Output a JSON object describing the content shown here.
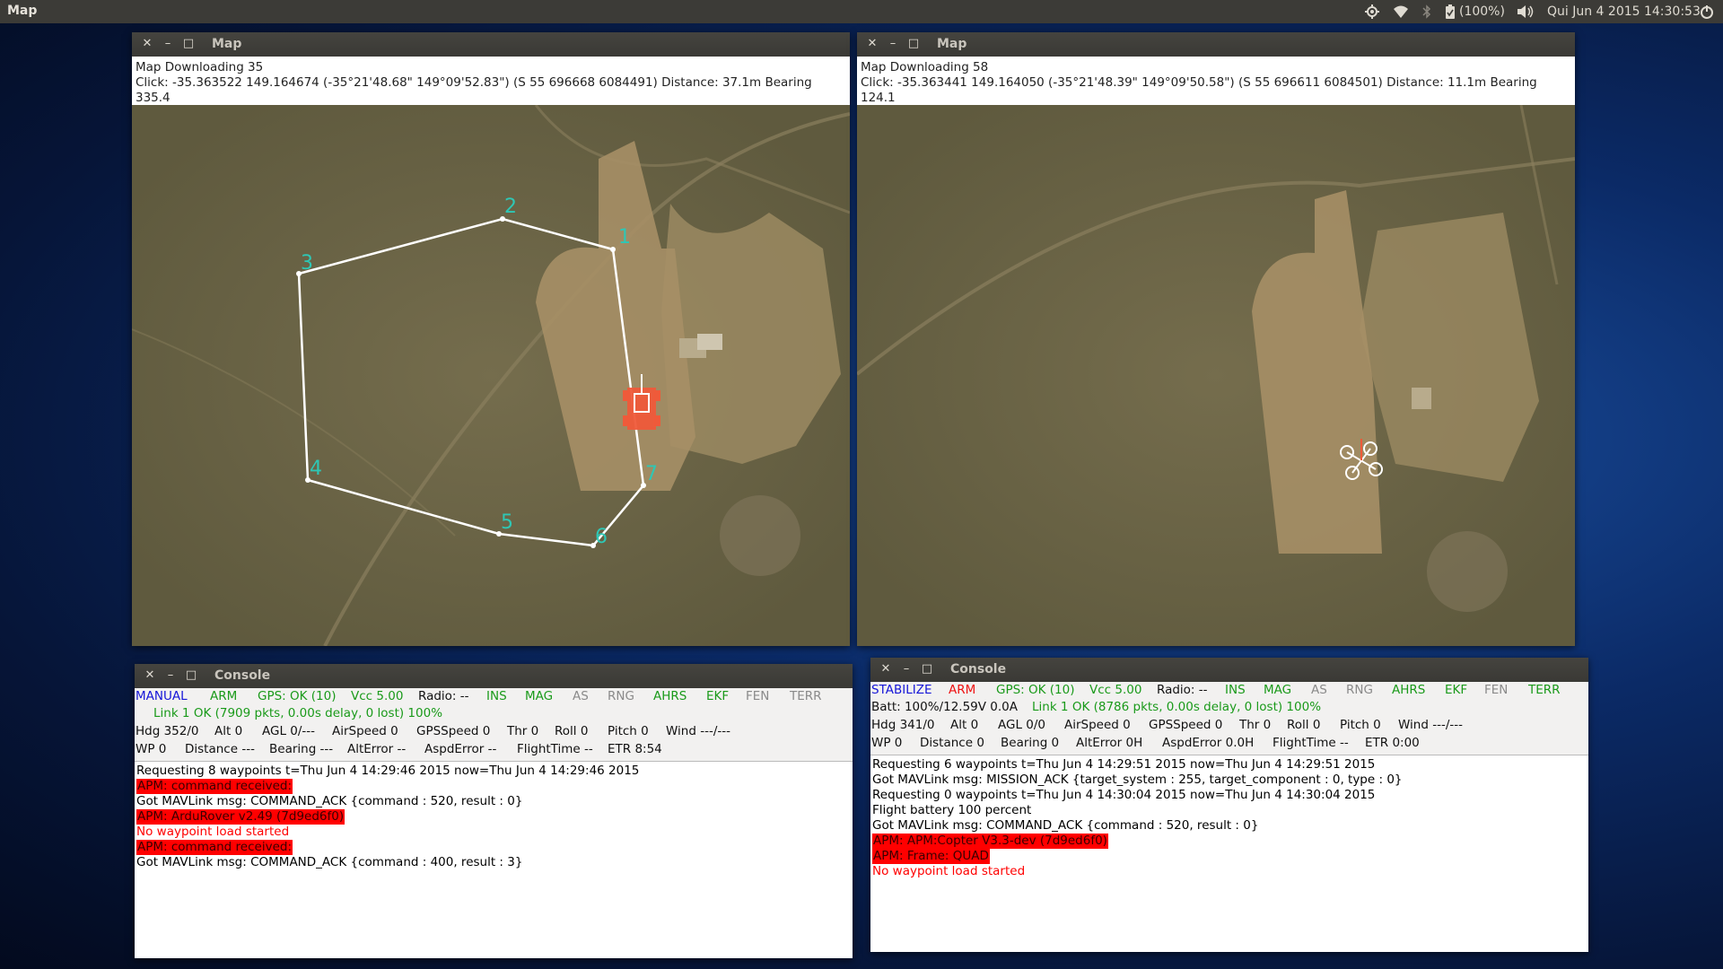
{
  "topbar": {
    "app_name": "Map",
    "battery": "(100%)",
    "clock": "Qui Jun  4 2015 14:30:53"
  },
  "icons": [
    "settings-icon",
    "wifi-icon",
    "bluetooth-icon",
    "battery-icon",
    "volume-icon",
    "session-icon",
    "close-icon",
    "minimize-icon",
    "maximize-icon"
  ],
  "map1": {
    "title": "Map",
    "line1": "Map Downloading 35",
    "line2": "Click: -35.363522 149.164674 (-35°21'48.68\" 149°09'52.83\") (S 55 696668 6084491)  Distance: 37.1m Bearing 335.4",
    "waypoints": [
      "1",
      "2",
      "3",
      "4",
      "5",
      "6",
      "7"
    ]
  },
  "map2": {
    "title": "Map",
    "line1": "Map Downloading 58",
    "line2": "Click: -35.363441 149.164050 (-35°21'48.39\" 149°09'50.58\") (S 55 696611 6084501)  Distance: 11.1m Bearing 124.1"
  },
  "console1": {
    "title": "Console",
    "row1": [
      {
        "t": "MANUAL",
        "c": "blue"
      },
      {
        "t": "ARM",
        "c": "green"
      },
      {
        "t": "GPS: OK (10)",
        "c": "green"
      },
      {
        "t": "Vcc 5.00",
        "c": "green"
      },
      {
        "t": "Radio: --",
        "c": "black"
      },
      {
        "t": "INS",
        "c": "green"
      },
      {
        "t": "MAG",
        "c": "green"
      },
      {
        "t": "AS",
        "c": "grey"
      },
      {
        "t": "RNG",
        "c": "grey"
      },
      {
        "t": "AHRS",
        "c": "green"
      },
      {
        "t": "EKF",
        "c": "green"
      },
      {
        "t": "FEN",
        "c": "grey"
      },
      {
        "t": "TERR",
        "c": "grey"
      }
    ],
    "row2": [
      {
        "t": "Link 1 OK (7909 pkts, 0.00s delay, 0 lost) 100%",
        "c": "green"
      }
    ],
    "row3": [
      {
        "t": "Hdg 352/0",
        "c": "black"
      },
      {
        "t": "Alt 0",
        "c": "black"
      },
      {
        "t": "AGL 0/---",
        "c": "black"
      },
      {
        "t": "AirSpeed 0",
        "c": "black"
      },
      {
        "t": "GPSSpeed 0",
        "c": "black"
      },
      {
        "t": "Thr 0",
        "c": "black"
      },
      {
        "t": "Roll 0",
        "c": "black"
      },
      {
        "t": "Pitch 0",
        "c": "black"
      },
      {
        "t": "Wind ---/---",
        "c": "black"
      }
    ],
    "row4": [
      {
        "t": "WP 0",
        "c": "black"
      },
      {
        "t": "Distance ---",
        "c": "black"
      },
      {
        "t": "Bearing ---",
        "c": "black"
      },
      {
        "t": "AltError --",
        "c": "black"
      },
      {
        "t": "AspdError --",
        "c": "black"
      },
      {
        "t": "FlightTime --",
        "c": "black"
      },
      {
        "t": "ETR 8:54",
        "c": "black"
      }
    ],
    "log": [
      {
        "t": "Requesting 8 waypoints t=Thu Jun  4 14:29:46 2015 now=Thu Jun  4 14:29:46 2015",
        "s": "normal"
      },
      {
        "t": "APM: command received:",
        "s": "hl"
      },
      {
        "t": "Got MAVLink msg: COMMAND_ACK {command : 520, result : 0}",
        "s": "normal"
      },
      {
        "t": "APM: ArduRover v2.49 (7d9ed6f0)",
        "s": "hl"
      },
      {
        "t": "No waypoint load started",
        "s": "red"
      },
      {
        "t": "APM: command received:",
        "s": "hl"
      },
      {
        "t": "Got MAVLink msg: COMMAND_ACK {command : 400, result : 3}",
        "s": "normal"
      }
    ]
  },
  "console2": {
    "title": "Console",
    "row1": [
      {
        "t": "STABILIZE",
        "c": "blue"
      },
      {
        "t": "ARM",
        "c": "red"
      },
      {
        "t": "GPS: OK (10)",
        "c": "green"
      },
      {
        "t": "Vcc 5.00",
        "c": "green"
      },
      {
        "t": "Radio: --",
        "c": "black"
      },
      {
        "t": "INS",
        "c": "green"
      },
      {
        "t": "MAG",
        "c": "green"
      },
      {
        "t": "AS",
        "c": "grey"
      },
      {
        "t": "RNG",
        "c": "grey"
      },
      {
        "t": "AHRS",
        "c": "green"
      },
      {
        "t": "EKF",
        "c": "green"
      },
      {
        "t": "FEN",
        "c": "grey"
      },
      {
        "t": "TERR",
        "c": "green"
      }
    ],
    "row2": [
      {
        "t": "Batt: 100%/12.59V 0.0A",
        "c": "black"
      },
      {
        "t": "Link 1 OK (8786 pkts, 0.00s delay, 0 lost) 100%",
        "c": "green"
      }
    ],
    "row3": [
      {
        "t": "Hdg 341/0",
        "c": "black"
      },
      {
        "t": "Alt 0",
        "c": "black"
      },
      {
        "t": "AGL 0/0",
        "c": "black"
      },
      {
        "t": "AirSpeed 0",
        "c": "black"
      },
      {
        "t": "GPSSpeed 0",
        "c": "black"
      },
      {
        "t": "Thr 0",
        "c": "black"
      },
      {
        "t": "Roll 0",
        "c": "black"
      },
      {
        "t": "Pitch 0",
        "c": "black"
      },
      {
        "t": "Wind ---/---",
        "c": "black"
      }
    ],
    "row4": [
      {
        "t": "WP 0",
        "c": "black"
      },
      {
        "t": "Distance 0",
        "c": "black"
      },
      {
        "t": "Bearing 0",
        "c": "black"
      },
      {
        "t": "AltError 0H",
        "c": "black"
      },
      {
        "t": "AspdError 0.0H",
        "c": "black"
      },
      {
        "t": "FlightTime --",
        "c": "black"
      },
      {
        "t": "ETR 0:00",
        "c": "black"
      }
    ],
    "log": [
      {
        "t": "Requesting 6 waypoints t=Thu Jun  4 14:29:51 2015 now=Thu Jun  4 14:29:51 2015",
        "s": "normal"
      },
      {
        "t": "Got MAVLink msg: MISSION_ACK {target_system : 255, target_component : 0, type : 0}",
        "s": "normal"
      },
      {
        "t": "Requesting 0 waypoints t=Thu Jun  4 14:30:04 2015 now=Thu Jun  4 14:30:04 2015",
        "s": "normal"
      },
      {
        "t": "Flight battery 100 percent",
        "s": "normal"
      },
      {
        "t": "Got MAVLink msg: COMMAND_ACK {command : 520, result : 0}",
        "s": "normal"
      },
      {
        "t": "APM: APM:Copter V3.3-dev (7d9ed6f0)",
        "s": "hl"
      },
      {
        "t": "APM: Frame: QUAD",
        "s": "hl"
      },
      {
        "t": "No waypoint load started",
        "s": "red"
      }
    ]
  }
}
